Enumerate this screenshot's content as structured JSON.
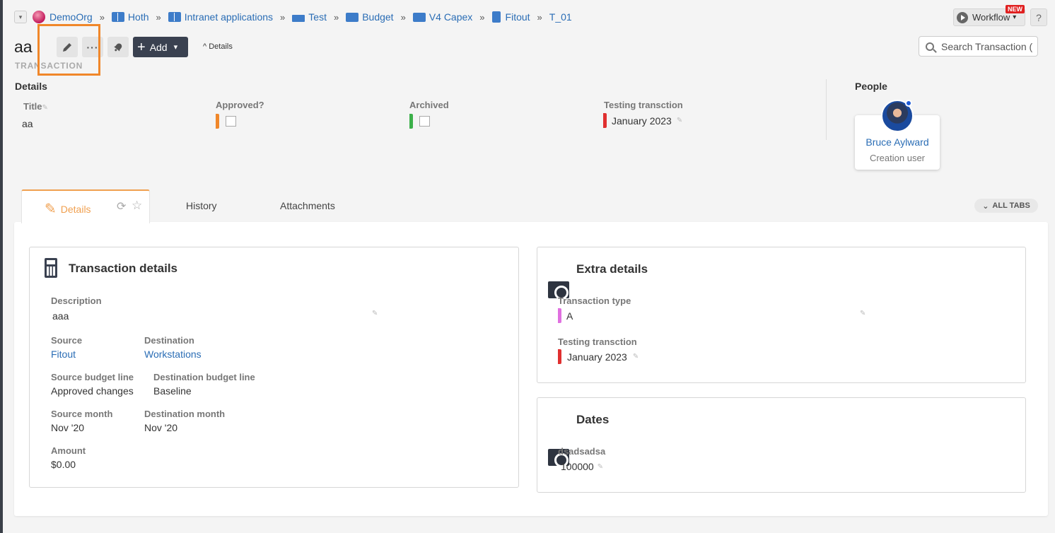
{
  "breadcrumb": {
    "items": [
      {
        "label": "DemoOrg"
      },
      {
        "label": "Hoth"
      },
      {
        "label": "Intranet applications"
      },
      {
        "label": "Test"
      },
      {
        "label": "Budget"
      },
      {
        "label": "V4 Capex"
      },
      {
        "label": "Fitout"
      },
      {
        "label": "T_01"
      }
    ],
    "separator": "»"
  },
  "header": {
    "workflow_label": "Workflow",
    "new_badge": "NEW",
    "help_label": "?",
    "title": "aa",
    "subtitle": "TRANSACTION",
    "add_label": "Add",
    "details_toggle": "Details",
    "search_placeholder": "Search Transaction ("
  },
  "summary": {
    "section_title": "Details",
    "fields": [
      {
        "label": "Title",
        "value": "aa"
      },
      {
        "label": "Approved?",
        "flag_color": "#f0872a"
      },
      {
        "label": "Archived",
        "flag_color": "#3cb04a"
      },
      {
        "label": "Testing transction",
        "value": "January 2023",
        "flag_color": "#e03030"
      }
    ]
  },
  "people": {
    "title": "People",
    "person": {
      "name": "Bruce Aylward",
      "role": "Creation user"
    }
  },
  "tabs": {
    "active": "Details",
    "items": [
      "Details",
      "History",
      "Attachments"
    ],
    "all_tabs_label": "ALL TABS"
  },
  "transaction_details": {
    "title": "Transaction details",
    "description_label": "Description",
    "description_value": "aaa",
    "source_label": "Source",
    "source_value": "Fitout",
    "destination_label": "Destination",
    "destination_value": "Workstations",
    "source_budget_line_label": "Source budget line",
    "source_budget_line_value": "Approved changes",
    "destination_budget_line_label": "Destination budget line",
    "destination_budget_line_value": "Baseline",
    "source_month_label": "Source month",
    "source_month_value": "Nov '20",
    "destination_month_label": "Destination month",
    "destination_month_value": "Nov '20",
    "amount_label": "Amount",
    "amount_value": "$0.00"
  },
  "extra_details": {
    "title": "Extra details",
    "transaction_type_label": "Transaction type",
    "transaction_type_value": "A",
    "transaction_type_color": "#e070e0",
    "testing_label": "Testing transction",
    "testing_value": "January 2023",
    "testing_color": "#e03030"
  },
  "dates": {
    "title": "Dates",
    "field_label": "dsadsadsa",
    "field_value": "100000"
  },
  "colors": {
    "accent": "#f0a050",
    "link": "#2a6db5",
    "highlight": "#f0872a"
  }
}
